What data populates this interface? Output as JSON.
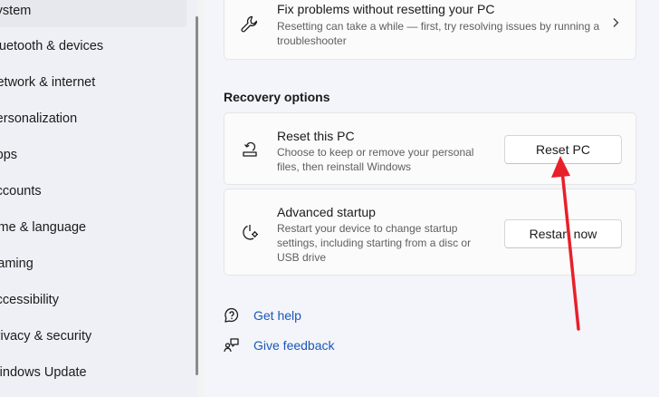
{
  "sidebar": {
    "items": [
      {
        "label": "System",
        "selected": true
      },
      {
        "label": "Bluetooth & devices"
      },
      {
        "label": "Network & internet"
      },
      {
        "label": "Personalization"
      },
      {
        "label": "Apps"
      },
      {
        "label": "Accounts"
      },
      {
        "label": "Time & language"
      },
      {
        "label": "Gaming"
      },
      {
        "label": "Accessibility"
      },
      {
        "label": "Privacy & security"
      },
      {
        "label": "Windows Update"
      }
    ]
  },
  "fix_card": {
    "icon": "wrench-icon",
    "title": "Fix problems without resetting your PC",
    "description": "Resetting can take a while — first, try resolving issues by running a troubleshooter"
  },
  "recovery": {
    "section_title": "Recovery options",
    "reset": {
      "icon": "reset-pc-icon",
      "title": "Reset this PC",
      "description": "Choose to keep or remove your personal files, then reinstall Windows",
      "button": "Reset PC"
    },
    "advanced": {
      "icon": "advanced-startup-icon",
      "title": "Advanced startup",
      "description": "Restart your device to change startup settings, including starting from a disc or USB drive",
      "button": "Restart now"
    }
  },
  "links": {
    "help": "Get help",
    "feedback": "Give feedback"
  },
  "colors": {
    "accent_link": "#1a56b8",
    "annotation_arrow": "#e8202a"
  }
}
